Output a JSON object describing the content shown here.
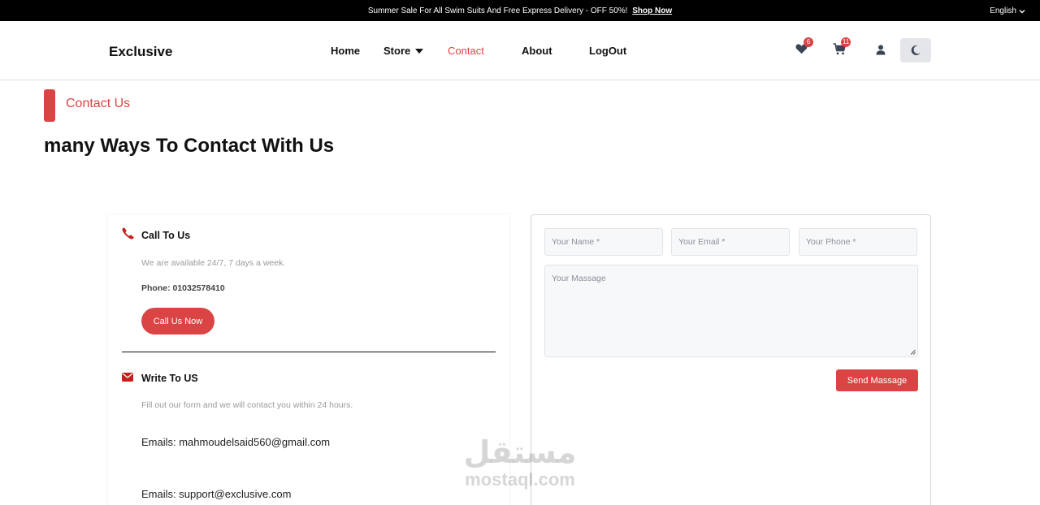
{
  "topbar": {
    "promo_text": "Summer Sale For All Swim Suits And Free Express Delivery - OFF 50%!",
    "promo_link": "Shop Now",
    "language": "English"
  },
  "header": {
    "logo": "Exclusive",
    "nav": {
      "home": "Home",
      "store": "Store",
      "contact": "Contact",
      "about": "About",
      "logout": "LogOut"
    },
    "wishlist_count": "6",
    "cart_count": "11"
  },
  "section": {
    "label": "Contact Us",
    "title": "many Ways To Contact With Us"
  },
  "call": {
    "heading": "Call To Us",
    "availability": "We are available 24/7, 7 days a week.",
    "phone": "Phone: 01032578410",
    "button": "Call Us Now"
  },
  "write": {
    "heading": "Write To US",
    "description": "Fill out our form and we will contact you within 24 hours.",
    "email1": "Emails: mahmoudelsaid560@gmail.com",
    "email2": "Emails: support@exclusive.com"
  },
  "form": {
    "name_placeholder": "Your Name *",
    "email_placeholder": "Your Email *",
    "phone_placeholder": "Your Phone *",
    "message_placeholder": "Your Massage",
    "send_button": "Send Massage"
  },
  "watermark": {
    "arabic": "مستقل",
    "latin": "mostaql.com"
  },
  "colors": {
    "accent": "#db4444",
    "topbar": "#000000"
  }
}
